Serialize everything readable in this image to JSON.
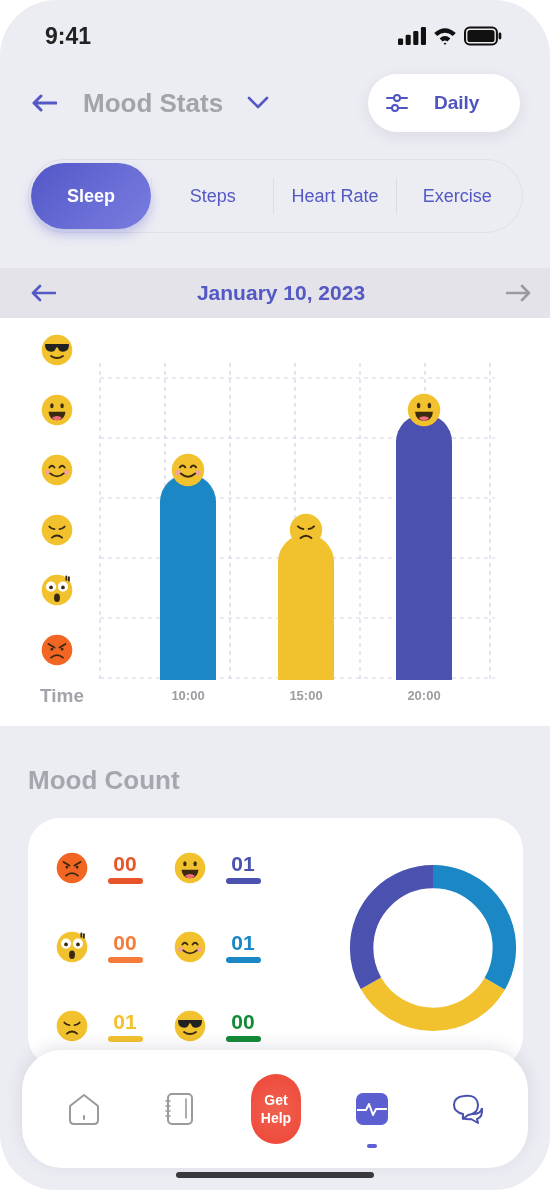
{
  "status_bar": {
    "time": "9:41"
  },
  "header": {
    "title": "Mood Stats",
    "filter_button": "Daily"
  },
  "tabs": [
    {
      "label": "Sleep",
      "selected": true
    },
    {
      "label": "Steps",
      "selected": false
    },
    {
      "label": "Heart Rate",
      "selected": false
    },
    {
      "label": "Exercise",
      "selected": false
    }
  ],
  "date_bar": {
    "date": "January 10, 2023",
    "next_disabled": true
  },
  "mood_chart": {
    "xlabel": "Time",
    "y_moods": [
      {
        "kind": "cool"
      },
      {
        "kind": "happy"
      },
      {
        "kind": "smiling"
      },
      {
        "kind": "sad"
      },
      {
        "kind": "shocked"
      },
      {
        "kind": "angry"
      }
    ],
    "bars": [
      {
        "time": "10:00",
        "kind": "smiling",
        "color": "#1b87c4"
      },
      {
        "time": "15:00",
        "kind": "sad",
        "color": "#f2c12e"
      },
      {
        "time": "20:00",
        "kind": "happy",
        "color": "#4a51ae"
      }
    ]
  },
  "mood_count": {
    "title": "Mood Count",
    "items": [
      {
        "kind": "angry",
        "count": "00",
        "color": "#e8542a"
      },
      {
        "kind": "happy",
        "count": "01",
        "color": "#4a51ae"
      },
      {
        "kind": "shocked",
        "count": "00",
        "color": "#f47b3a"
      },
      {
        "kind": "smiling",
        "count": "01",
        "color": "#1b87c4"
      },
      {
        "kind": "sad",
        "count": "01",
        "color": "#f2c12e"
      },
      {
        "kind": "cool",
        "count": "00",
        "color": "#138a36"
      }
    ]
  },
  "nav": [
    {
      "kind": "home",
      "selected": false
    },
    {
      "kind": "journal",
      "selected": false
    },
    {
      "kind": "help",
      "label": "Get Help",
      "selected": false
    },
    {
      "kind": "stats",
      "selected": true
    },
    {
      "kind": "chat",
      "selected": false
    }
  ]
}
